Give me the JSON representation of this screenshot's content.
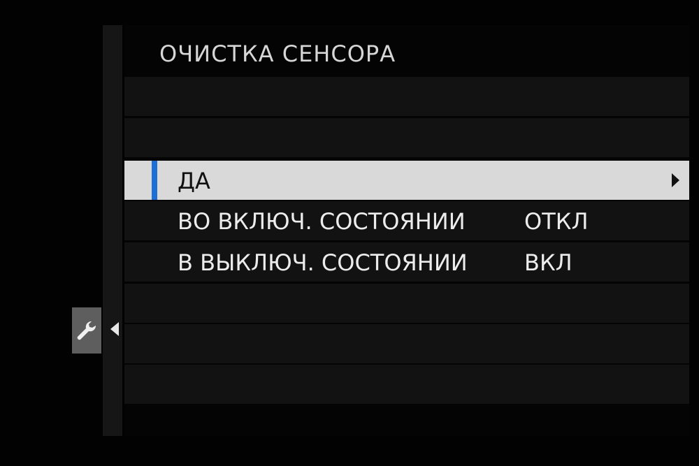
{
  "menu": {
    "title": "ОЧИСТКА СЕНСОРА",
    "items": [
      {
        "label": "ДА",
        "value": "",
        "selected": true
      },
      {
        "label": "ВО ВКЛЮЧ. СОСТОЯНИИ",
        "value": "ОТКЛ",
        "selected": false
      },
      {
        "label": "В ВЫКЛЮЧ. СОСТОЯНИИ",
        "value": "ВКЛ",
        "selected": false
      }
    ]
  },
  "sidebar": {
    "active_tab_icon": "wrench-icon"
  },
  "colors": {
    "background": "#020202",
    "row_background": "#121212",
    "selected_row_background": "#d9d9d9",
    "selection_accent": "#1d6fd6",
    "active_tab_background": "#5e5e5e"
  }
}
